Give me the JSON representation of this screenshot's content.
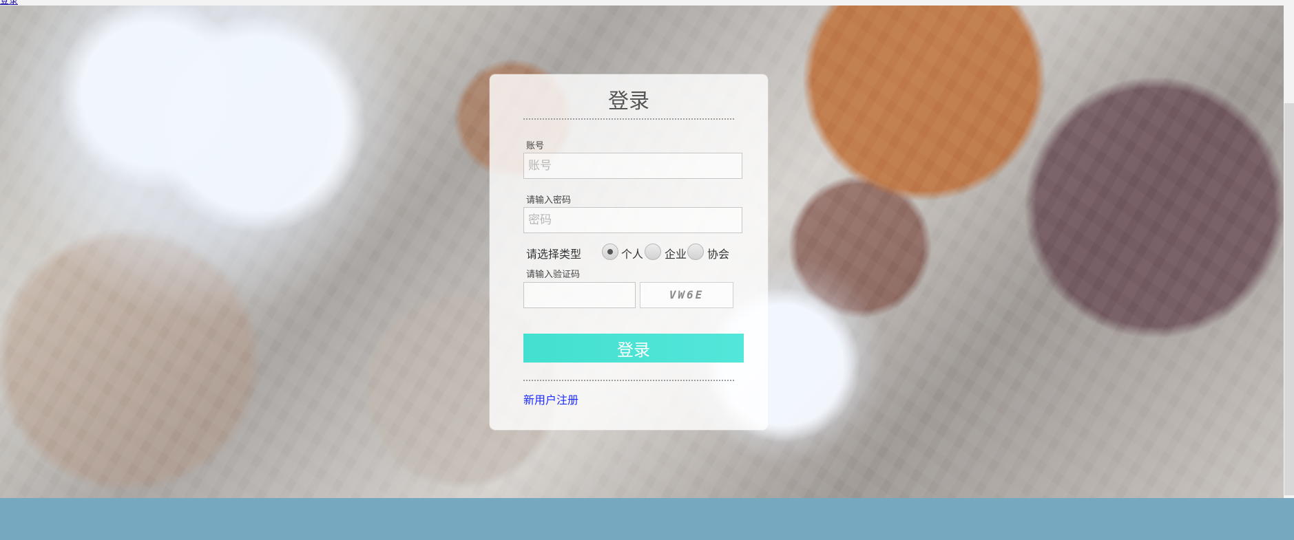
{
  "top_link": "登录",
  "panel": {
    "title": "登录",
    "account_label": "账号",
    "account_placeholder": "账号",
    "password_label": "请输入密码",
    "password_placeholder": "密码",
    "type_label": "请选择类型",
    "type_options": [
      {
        "label": "个人",
        "selected": true
      },
      {
        "label": "企业",
        "selected": false
      },
      {
        "label": "协会",
        "selected": false
      }
    ],
    "captcha_label": "请输入验证码",
    "captcha_code": "VW6E",
    "submit_label": "登录",
    "register_link": "新用户注册"
  }
}
